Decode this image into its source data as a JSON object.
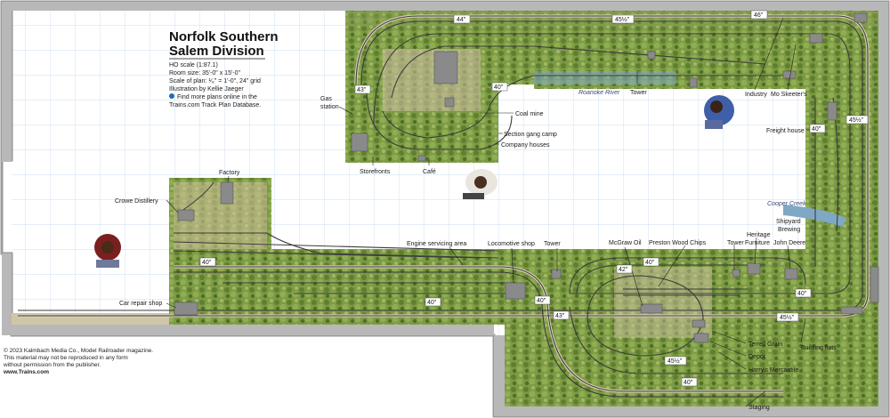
{
  "title": {
    "line1": "Norfolk Southern",
    "line2": "Salem Division"
  },
  "info": {
    "scale": "HO scale (1:87.1)",
    "room": "Room size: 35'-0\" x 15'-0\"",
    "plan_scale": "Scale of plan: ¹⁄₈\" = 1'-0\", 24\" grid",
    "illustrator": "Illustration by Kellie Jaeger",
    "more1": "Find more plans online in the",
    "more2": "Trains.com Track Plan Database."
  },
  "copyright": {
    "line1": "© 2023 Kalmbach Media Co., Model Railroader magazine.",
    "line2": "This material may not be reproduced in any form",
    "line3": "without permission from the publisher.",
    "line4": "www.Trains.com"
  },
  "labels": {
    "gas_station1": "Gas",
    "gas_station2": "station",
    "coal_mine": "Coal mine",
    "section_gang": "Section gang camp",
    "company_houses": "Company houses",
    "storefronts": "Storefronts",
    "cafe": "Café",
    "roanoke": "Roanoke River",
    "tower_top": "Tower",
    "industry": "Industry",
    "mo_skeeters": "Mo Skeeter's",
    "freight_house": "Freight house",
    "cooper_creek": "Cooper Creek",
    "shipyard1": "Shipyard",
    "shipyard2": "Brewing",
    "heritage1": "Heritage",
    "heritage2": "Furniture",
    "john_deere": "John Deere",
    "tower_right": "Tower",
    "preston": "Preston Wood Chips",
    "mcgraw": "McGraw Oil",
    "tower_mid": "Tower",
    "loco_shop": "Locomotive shop",
    "engine_area": "Engine servicing area",
    "factory": "Factory",
    "crowe": "Crowe Distillery",
    "car_repair": "Car repair shop",
    "terrell": "Terrell Grain",
    "depot": "Depot",
    "harrys": "Harry's Mercantile",
    "staging": "Staging",
    "building_flats": "Building flats"
  },
  "grades": {
    "g44": "44\"",
    "g45a": "45½\"",
    "g46": "46\"",
    "g43a": "43\"",
    "g40a": "40\"",
    "g45b": "45½\"",
    "g40b": "40\"",
    "g40c": "40\"",
    "g40d": "40\"",
    "g42": "42\"",
    "g40e": "40\"",
    "g43b": "43\"",
    "g40f": "40\"",
    "g40g": "40\"",
    "g45c": "45½\"",
    "g45d": "45½\"",
    "g40h": "40\""
  },
  "colors": {
    "grid": "#bcd4ea",
    "wall": "#9a9a9a",
    "scenery": "#6f8f3c",
    "ballast": "#d6ccb2"
  }
}
